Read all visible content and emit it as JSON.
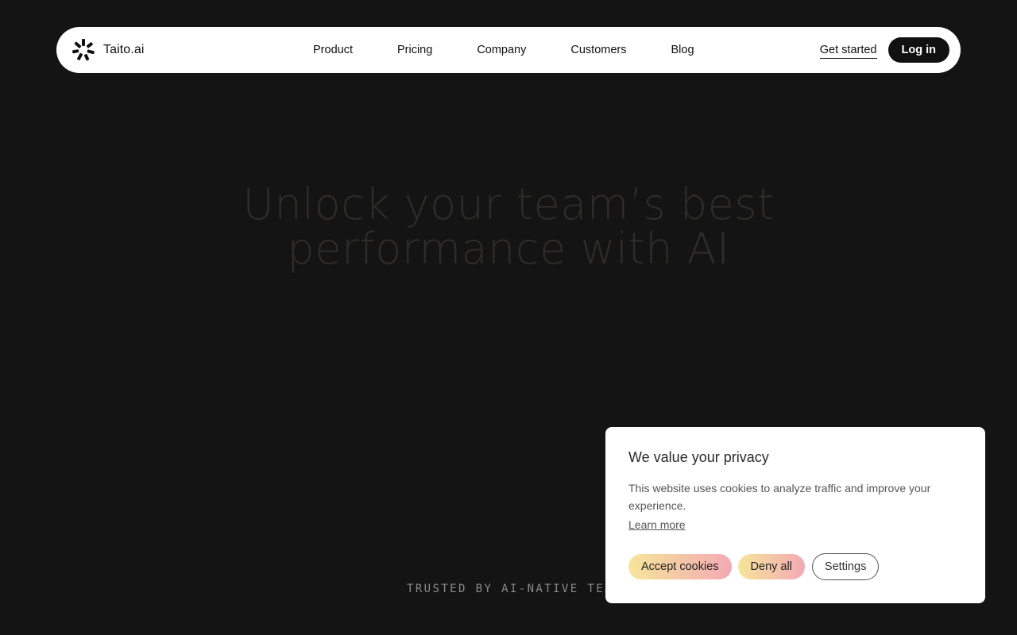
{
  "nav": {
    "brand": "Taito.ai",
    "brand_icon": "sparkle-burst-icon",
    "links": [
      "Product",
      "Pricing",
      "Company",
      "Customers",
      "Blog"
    ],
    "get_started": "Get started",
    "login": "Log in"
  },
  "hero": {
    "line1": "Unlock your team’s best",
    "line2": "performance with AI"
  },
  "trusted": "TRUSTED BY AI-NATIVE TEAMS",
  "cookie": {
    "title": "We value your privacy",
    "text": "This website uses cookies to analyze traffic and improve your experience.",
    "learn_more": "Learn more",
    "accept": "Accept cookies",
    "deny": "Deny all",
    "settings": "Settings"
  },
  "colors": {
    "background": "#141414",
    "nav_bg": "#ffffff",
    "hero_text": "#2f2c28",
    "gradient_start": "#f6e59a",
    "gradient_end": "#f3a9b4"
  }
}
